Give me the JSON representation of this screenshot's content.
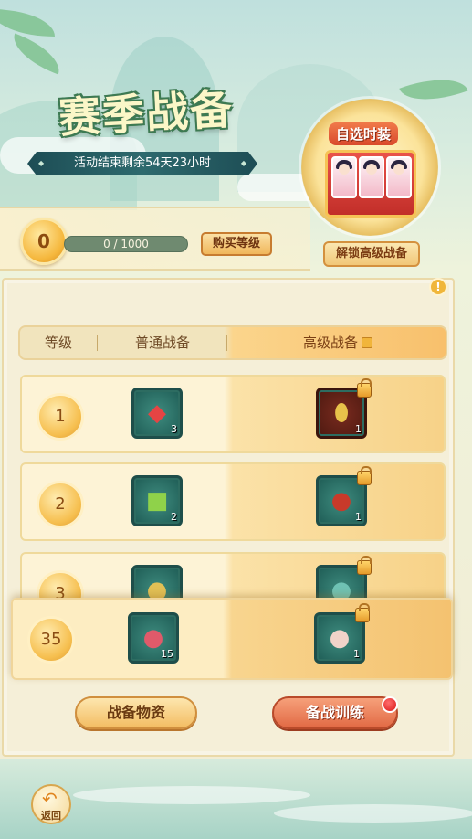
{
  "header": {
    "title": "赛季战备",
    "countdown": "活动结束剩余54天23小时"
  },
  "promo": {
    "label": "自选时装",
    "unlock_button": "解锁高级战备"
  },
  "level": {
    "current": "0",
    "progress_text": "0 / 1000",
    "progress_fraction": 0,
    "buy_button": "购买等级"
  },
  "info_button": "!",
  "table": {
    "headers": {
      "level": "等级",
      "normal": "普通战备",
      "advanced": "高级战备"
    },
    "rows": [
      {
        "level": "1",
        "normal_qty": "3",
        "normal_icon": "red-crystal-icon",
        "adv_qty": "1",
        "adv_icon": "golden-egg-icon",
        "adv_locked": true
      },
      {
        "level": "2",
        "normal_qty": "2",
        "normal_icon": "gift-box-icon",
        "adv_qty": "1",
        "adv_icon": "red-pouch-icon",
        "adv_locked": true
      },
      {
        "level": "3",
        "normal_qty": "",
        "normal_icon": "coin-item-icon",
        "adv_qty": "",
        "adv_icon": "turtle-shell-icon",
        "adv_locked": true
      }
    ],
    "sticky_row": {
      "level": "35",
      "normal_qty": "15",
      "normal_icon": "red-orb-icon",
      "adv_qty": "1",
      "adv_icon": "lucky-bag-icon",
      "adv_locked": true
    }
  },
  "buttons": {
    "supplies": "战备物资",
    "training": "备战训练"
  },
  "back": {
    "label": "返回"
  }
}
